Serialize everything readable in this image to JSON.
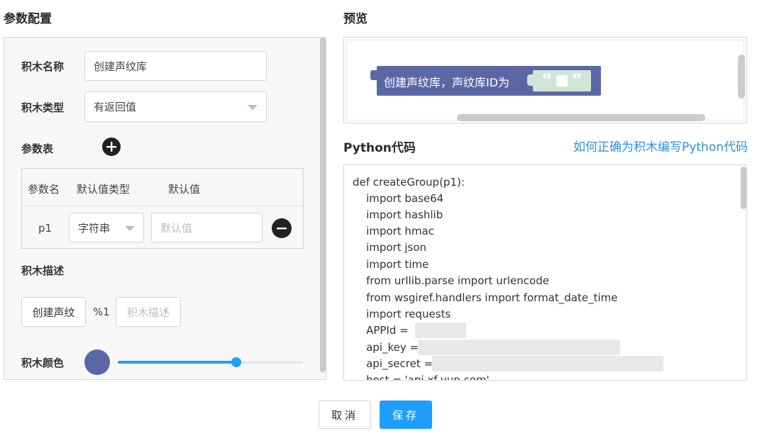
{
  "config": {
    "title": "参数配置",
    "name_label": "积木名称",
    "name_value": "创建声纹库",
    "type_label": "积木类型",
    "type_value": "有返回值",
    "params_label": "参数表",
    "params_headers": [
      "参数名",
      "默认值类型",
      "默认值"
    ],
    "params_rows": [
      {
        "name": "p1",
        "type": "字符串",
        "default_placeholder": "默认值"
      }
    ],
    "desc_label": "积木描述",
    "desc_chip": "创建声纹",
    "desc_param": "%1",
    "desc_placeholder": "积木描述",
    "color_label": "积木颜色",
    "color_value": "#5b67a5",
    "color_slider": 0.64
  },
  "preview": {
    "title": "预览",
    "block_text": "创建声纹库，声纹库ID为",
    "open_quote": "“",
    "close_quote": "”"
  },
  "code": {
    "title": "Python代码",
    "help_link": "如何正确为积木编写Python代码",
    "lines": [
      "def createGroup(p1):",
      "    import base64",
      "    import hashlib",
      "    import hmac",
      "    import json",
      "    import time",
      "    from urllib.parse import urlencode",
      "    from wsgiref.handlers import format_date_time",
      "    import requests",
      "    APPId = ",
      "    api_key = ",
      "    api_secret = ",
      "    host = 'api.xf-yun.com'"
    ]
  },
  "actions": {
    "cancel": "取消",
    "save": "保存"
  },
  "colors": {
    "accent": "#1e9fff",
    "block": "#5b67a5"
  }
}
